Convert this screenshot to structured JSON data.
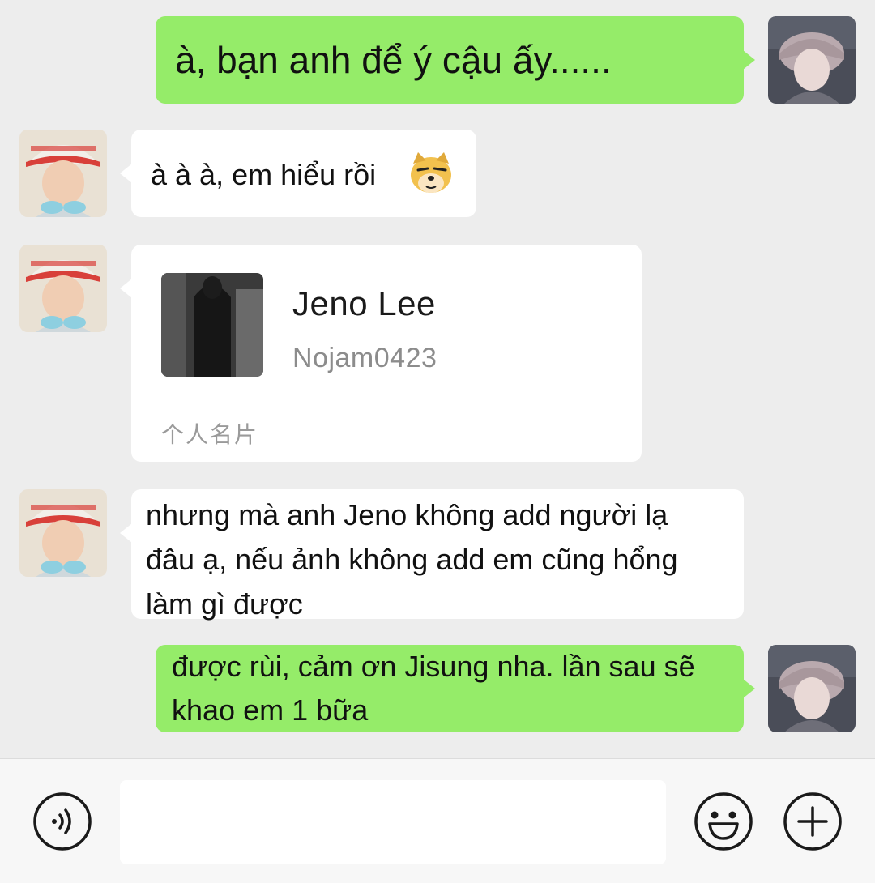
{
  "messages": [
    {
      "sender": "me",
      "text": "à, bạn anh để ý cậu ấy......"
    },
    {
      "sender": "other",
      "text": "à à à, em hiểu rồi",
      "emoji": "dog-emoji"
    },
    {
      "sender": "other",
      "type": "contact_card",
      "card": {
        "name": "Jeno Lee",
        "id": "Nojam0423",
        "label": "个人名片"
      }
    },
    {
      "sender": "other",
      "text": "nhưng mà anh Jeno không add người lạ đâu ạ, nếu ảnh không add em cũng hổng làm gì được"
    },
    {
      "sender": "me",
      "text": "được rùi, cảm ơn Jisung nha. lần sau sẽ khao em 1 bữa"
    }
  ],
  "input_bar": {
    "placeholder": "",
    "icons": [
      "voice-icon",
      "emoji-smile-icon",
      "plus-icon"
    ]
  },
  "colors": {
    "background": "#ededed",
    "my_bubble": "#95ec69",
    "their_bubble": "#ffffff",
    "input_bar": "#f7f7f7"
  }
}
